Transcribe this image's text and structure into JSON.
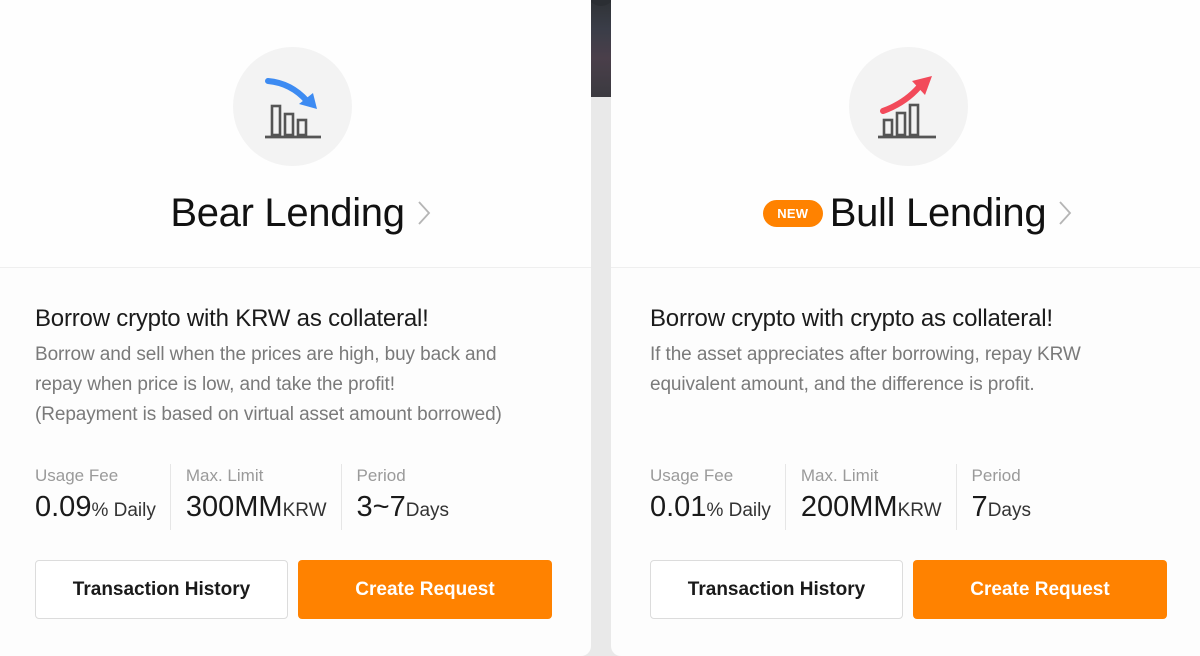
{
  "colors": {
    "accent": "#ff8200",
    "bear_arrow": "#3d8bf2",
    "bull_arrow": "#f24a5a"
  },
  "cards": [
    {
      "id": "bear",
      "icon": "bar-chart-down-icon",
      "badge": null,
      "title": "Bear Lending",
      "headline": "Borrow crypto with KRW as collateral!",
      "description": [
        "Borrow and sell when the prices are high, buy back and",
        "repay when price is low, and take the profit!",
        "(Repayment is based on virtual asset amount borrowed)"
      ],
      "stats": [
        {
          "label": "Usage Fee",
          "value": "0.09",
          "unit": "% Daily"
        },
        {
          "label": "Max. Limit",
          "value": "300MM",
          "unit": "KRW"
        },
        {
          "label": "Period",
          "value": "3~7",
          "unit": "Days"
        }
      ],
      "buttons": {
        "secondary": "Transaction History",
        "primary": "Create Request"
      }
    },
    {
      "id": "bull",
      "icon": "bar-chart-up-icon",
      "badge": "NEW",
      "title": "Bull Lending",
      "headline": "Borrow crypto with crypto as collateral!",
      "description": [
        "If the asset appreciates after borrowing, repay KRW",
        "equivalent amount, and the difference is profit."
      ],
      "stats": [
        {
          "label": "Usage Fee",
          "value": "0.01",
          "unit": "% Daily"
        },
        {
          "label": "Max. Limit",
          "value": "200MM",
          "unit": "KRW"
        },
        {
          "label": "Period",
          "value": "7",
          "unit": "Days"
        }
      ],
      "buttons": {
        "secondary": "Transaction History",
        "primary": "Create Request"
      }
    }
  ]
}
